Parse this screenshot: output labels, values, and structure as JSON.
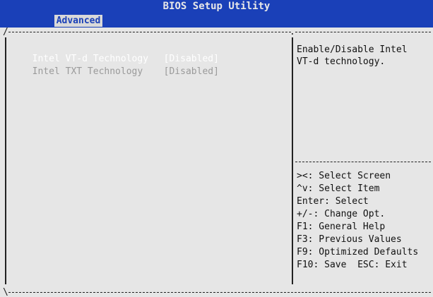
{
  "title": "BIOS Setup Utility",
  "tabs": [
    {
      "label": "Advanced",
      "active": true
    }
  ],
  "items": [
    {
      "label": "Intel VT-d Technology",
      "value": "[Disabled]",
      "state": "selected"
    },
    {
      "label": "Intel TXT Technology",
      "value": "[Disabled]",
      "state": "disabled"
    }
  ],
  "help": {
    "line1": "Enable/Disable Intel",
    "line2": "VT-d technology."
  },
  "keys": [
    "><: Select Screen",
    "^v: Select Item",
    "Enter: Select",
    "+/-: Change Opt.",
    "F1: General Help",
    "F3: Previous Values",
    "F9: Optimized Defaults",
    "F10: Save  ESC: Exit"
  ],
  "colors": {
    "bios_blue": "#1a40b8",
    "background": "#e6e6e6",
    "selected_text": "#ffffff",
    "disabled_text": "#9a9a9a"
  }
}
